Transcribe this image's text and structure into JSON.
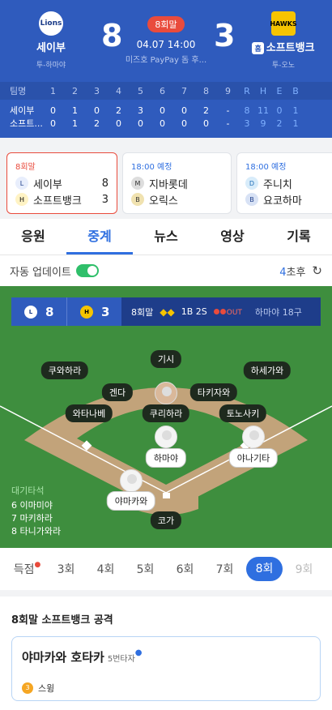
{
  "game": {
    "away": {
      "name": "세이부",
      "pitcher_label": "투",
      "pitcher": "하마야",
      "score": "8",
      "logo_text": "Lions"
    },
    "home": {
      "name": "소프트뱅크",
      "pitcher_label": "투",
      "pitcher": "오노",
      "score": "3",
      "logo_text": "HAWKS",
      "home_badge": "홈"
    },
    "inning_badge": "8회말",
    "datetime": "04.07 14:00",
    "stadium": "미즈호 PayPay 돔 후..."
  },
  "boxscore": {
    "headers": [
      "팀명",
      "1",
      "2",
      "3",
      "4",
      "5",
      "6",
      "7",
      "8",
      "9",
      "R",
      "H",
      "E",
      "B"
    ],
    "rows": [
      {
        "team": "세이부",
        "innings": [
          "0",
          "1",
          "0",
          "2",
          "3",
          "0",
          "0",
          "2",
          "-"
        ],
        "rheb": [
          "8",
          "11",
          "0",
          "1"
        ]
      },
      {
        "team": "소프트...",
        "innings": [
          "0",
          "1",
          "2",
          "0",
          "0",
          "0",
          "0",
          "0",
          "-"
        ],
        "rheb": [
          "3",
          "9",
          "2",
          "1"
        ]
      }
    ]
  },
  "games": [
    {
      "status": "8회말",
      "teams": [
        {
          "name": "세이부",
          "score": "8"
        },
        {
          "name": "소프트뱅크",
          "score": "3"
        }
      ]
    },
    {
      "status": "18:00 예정",
      "teams": [
        {
          "name": "지바롯데",
          "score": ""
        },
        {
          "name": "오릭스",
          "score": ""
        }
      ]
    },
    {
      "status": "18:00 예정",
      "teams": [
        {
          "name": "주니치",
          "score": ""
        },
        {
          "name": "요코하마",
          "score": ""
        }
      ]
    }
  ],
  "tabs": [
    "응원",
    "중계",
    "뉴스",
    "영상",
    "기록"
  ],
  "auto_update": {
    "label": "자동 업데이트",
    "ago_num": "4",
    "ago_unit": "초후"
  },
  "scorebug": {
    "away_score": "8",
    "home_score": "3",
    "inning": "8회말",
    "count": "1B 2S",
    "out_label": "OUT",
    "pitcher_info": "하마야 18구"
  },
  "fielders": {
    "lf": "쿠와하라",
    "cf": "기시",
    "rf": "하세가와",
    "ss": "겐다",
    "b2": "타키자와",
    "b3": "와타나베",
    "p": "쿠리하라",
    "b1": "토노사키",
    "pitcher": "하마야",
    "runner1": "야나기타",
    "batter": "야마카와",
    "catcher": "코가"
  },
  "on_deck": {
    "title": "대기타석",
    "list": [
      "6 이마미야",
      "7 마키하라",
      "8 타니가와라"
    ]
  },
  "innings_nav": {
    "first": "득점",
    "items": [
      "3회",
      "4회",
      "5회",
      "6회",
      "7회",
      "8회",
      "9회"
    ]
  },
  "section": {
    "title": "8회말 소프트뱅크 공격",
    "batter": "야마카와 호타카",
    "order": "5번타자",
    "event_num": "3",
    "event": "스윙"
  }
}
